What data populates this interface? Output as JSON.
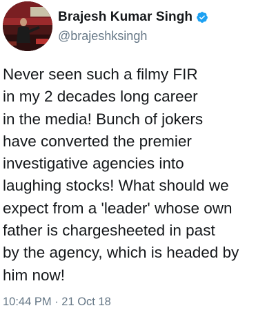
{
  "user": {
    "display_name": "Brajesh Kumar Singh",
    "handle": "@brajeshksingh",
    "verified": true
  },
  "tweet": {
    "lines": [
      "Never seen such a filmy FIR",
      "in my 2 decades long career",
      "in the media! Bunch of jokers",
      "have converted the premier",
      "investigative agencies into",
      "laughing stocks! What should we",
      "expect from a 'leader' whose own",
      "father is chargesheeted in past",
      "by the agency, which is headed by",
      "him now!"
    ],
    "timestamp": "10:44 PM · 21 Oct 18"
  },
  "colors": {
    "text": "#14171a",
    "secondary": "#657786",
    "verified_badge": "#1da1f2"
  },
  "icons": {
    "verified": "verified-badge-icon",
    "avatar": "profile-photo"
  }
}
